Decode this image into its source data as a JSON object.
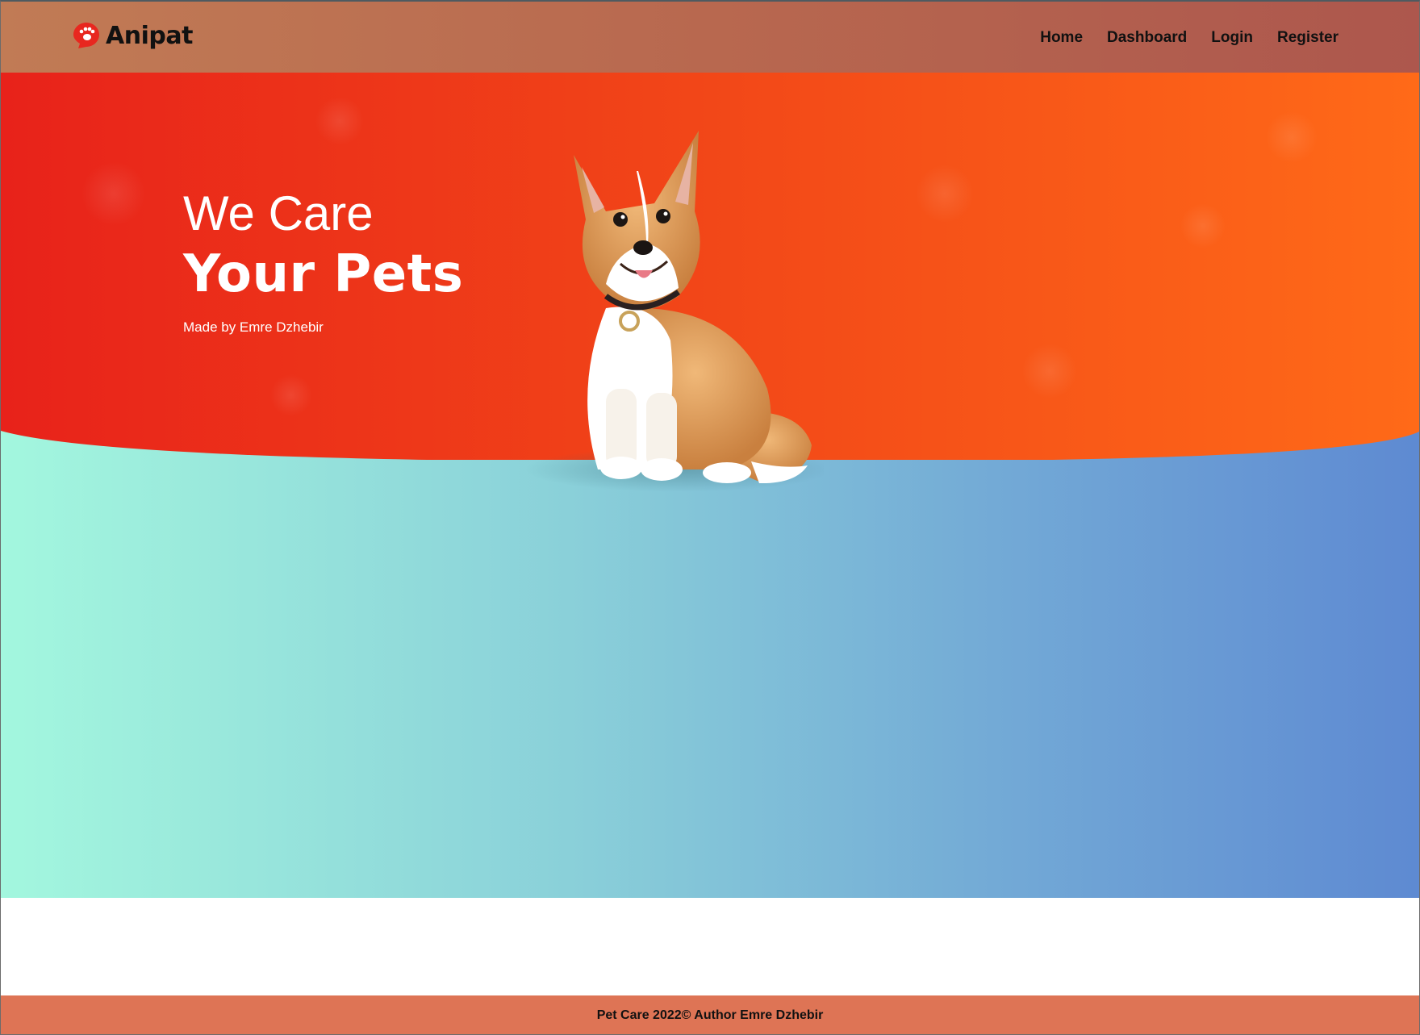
{
  "header": {
    "brand": "Anipat",
    "nav": [
      "Home",
      "Dashboard",
      "Login",
      "Register"
    ]
  },
  "hero": {
    "title_line1": "We Care",
    "title_line2": "Your Pets",
    "subtitle": "Made by Emre Dzhebir"
  },
  "footer": {
    "text": "Pet Care 2022© Author Emre Dzhebir"
  },
  "icons": {
    "logo": "paw-chat-bubble-icon",
    "hero_image": "corgi-dog-illustration"
  },
  "colors": {
    "header_start": "#c17b55",
    "header_end": "#ad574d",
    "hero_start": "#e8221a",
    "hero_end": "#ff6a18",
    "section_start": "#a3f7de",
    "section_end": "#5e8ad2",
    "footer": "#de7455",
    "logo_red": "#e8271f"
  }
}
